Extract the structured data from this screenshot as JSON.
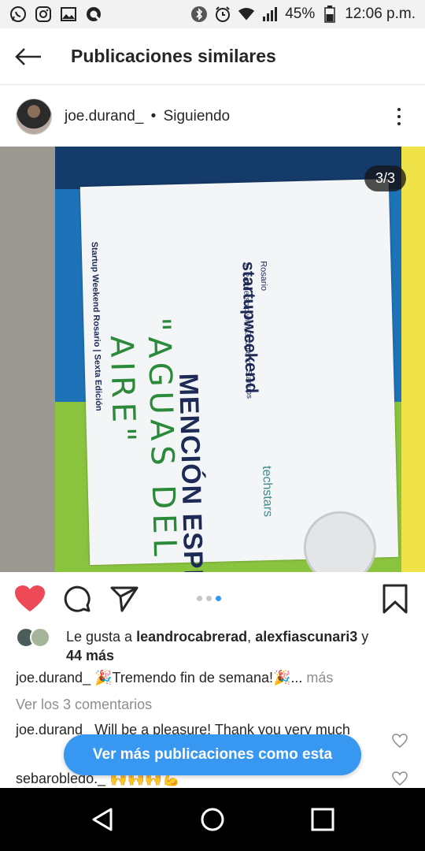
{
  "status_bar": {
    "battery": "45%",
    "time": "12:06 p.m.",
    "icons": [
      "whatsapp-icon",
      "instagram-icon",
      "gallery-icon",
      "app-q-icon",
      "bluetooth-icon",
      "alarm-icon",
      "wifi-icon",
      "signal-icon",
      "battery-icon"
    ]
  },
  "header": {
    "title": "Publicaciones similares",
    "back_icon": "arrow-left-icon"
  },
  "post": {
    "username": "joe.durand_",
    "separator": "•",
    "follow_status": "Siguiendo",
    "counter": "3/3",
    "image": {
      "heading": "MENCIÓN ESPECIAL",
      "handwritten_line1": "\"AGUAS DEL",
      "handwritten_line2": "AIRE\"",
      "brand": "startupweekend",
      "brand_city": "Rosario",
      "brand_sub": "In Partnership with Google for Startups",
      "partner": "techstars",
      "side_text": "Startup Weekend Rosario | Sexta Edición"
    }
  },
  "actions": {
    "like_icon": "heart-filled-icon",
    "comment_icon": "comment-icon",
    "share_icon": "send-icon",
    "save_icon": "bookmark-icon",
    "carousel_count": 3,
    "carousel_active": 3
  },
  "likes": {
    "prefix": "Le gusta a",
    "user1": "leandrocabrerad",
    "separator": ",",
    "user2": "alexfiascunari3",
    "conjunction": "y",
    "others": "44 más"
  },
  "caption": {
    "username": "joe.durand_",
    "text": "🎉Tremendo fin de semana!🎉...",
    "more": "más"
  },
  "view_comments": "Ver los 3 comentarios",
  "comments": [
    {
      "username": "joe.durand_",
      "text": "Will be a pleasure! Thank you very much"
    },
    {
      "username": "sebarobledo._",
      "text": "🙌🙌🙌💪"
    }
  ],
  "more_posts_button": "Ver más publicaciones como esta",
  "colors": {
    "accent": "#3897f0",
    "like_red": "#ed4956",
    "text": "#262626",
    "muted": "#8e8e8e"
  }
}
